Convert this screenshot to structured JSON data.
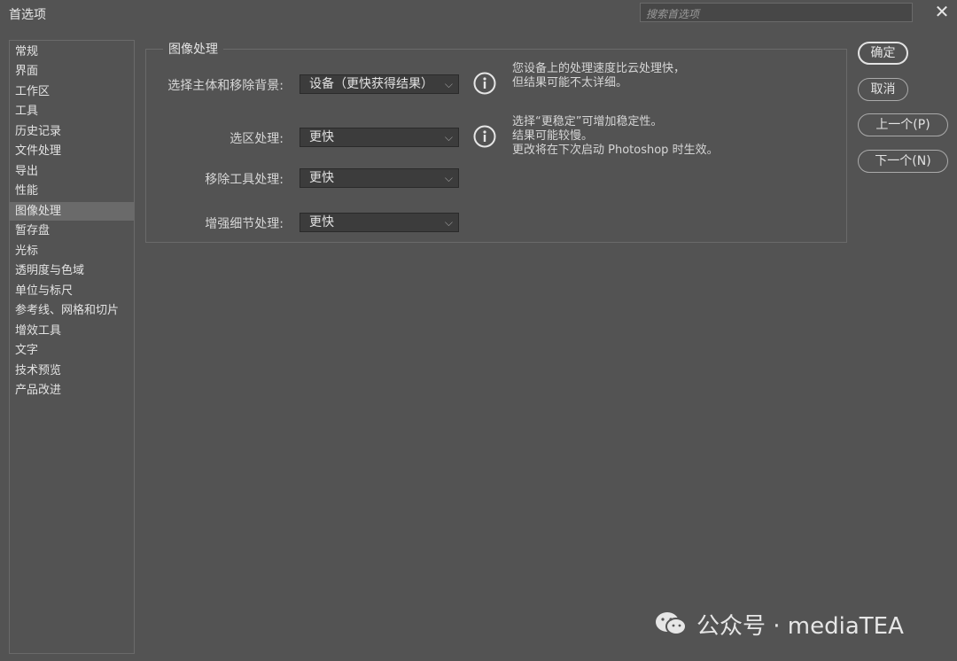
{
  "window": {
    "title": "首选项",
    "search_placeholder": "搜索首选项"
  },
  "sidebar": {
    "items": [
      {
        "label": "常规"
      },
      {
        "label": "界面"
      },
      {
        "label": "工作区"
      },
      {
        "label": "工具"
      },
      {
        "label": "历史记录"
      },
      {
        "label": "文件处理"
      },
      {
        "label": "导出"
      },
      {
        "label": "性能"
      },
      {
        "label": "图像处理"
      },
      {
        "label": "暂存盘"
      },
      {
        "label": "光标"
      },
      {
        "label": "透明度与色域"
      },
      {
        "label": "单位与标尺"
      },
      {
        "label": "参考线、网格和切片"
      },
      {
        "label": "增效工具"
      },
      {
        "label": "文字"
      },
      {
        "label": "技术预览"
      },
      {
        "label": "产品改进"
      }
    ],
    "active": "图像处理"
  },
  "panel": {
    "title": "图像处理",
    "rows": [
      {
        "label": "选择主体和移除背景:",
        "value": "设备（更快获得结果）"
      },
      {
        "label": "选区处理:",
        "value": "更快"
      },
      {
        "label": "移除工具处理:",
        "value": "更快"
      },
      {
        "label": "增强细节处理:",
        "value": "更快"
      }
    ],
    "info1": [
      "您设备上的处理速度比云处理快，",
      "但结果可能不太详细。"
    ],
    "info2": [
      "选择“更稳定”可增加稳定性。",
      "结果可能较慢。",
      "更改将在下次启动 Photoshop 时生效。"
    ]
  },
  "buttons": {
    "ok": "确定",
    "cancel": "取消",
    "prev": "上一个(P)",
    "next": "下一个(N)"
  },
  "watermark": {
    "text": "公众号 · mediaTEA"
  }
}
